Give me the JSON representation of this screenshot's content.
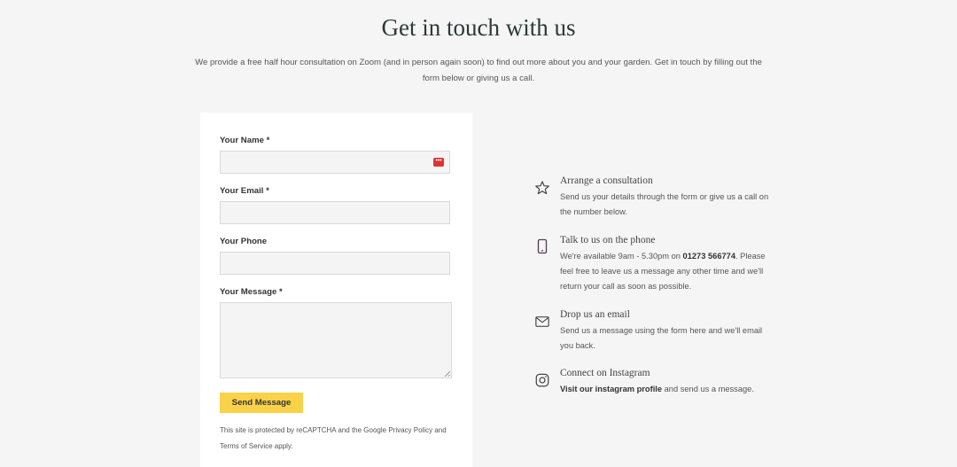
{
  "header": {
    "title": "Get in touch with us",
    "intro": "We provide a free half hour consultation on Zoom (and in person again soon) to find out more about you and your garden. Get in touch by filling out the form below or giving us a call."
  },
  "form": {
    "name_label": "Your Name *",
    "name_value": "",
    "email_label": "Your Email *",
    "email_value": "",
    "phone_label": "Your Phone",
    "phone_value": "",
    "message_label": "Your Message *",
    "message_value": "",
    "password_manager_icon": "password-manager-icon",
    "password_manager_glyph": "•••",
    "submit_label": "Send Message",
    "recaptcha_notice": "This site is protected by reCAPTCHA and the Google Privacy Policy and Terms of Service apply."
  },
  "info": {
    "consultation": {
      "icon": "star-icon",
      "title": "Arrange a consultation",
      "text": "Send us your details through the form or give us a call on the number below."
    },
    "phone": {
      "icon": "phone-icon",
      "title": "Talk to us on the phone",
      "text_prefix": "We're available 9am - 5.30pm on ",
      "number": "01273 566774",
      "text_suffix": ". Please feel free to leave us a message any other time and we'll return your call as soon as possible."
    },
    "email": {
      "icon": "envelope-icon",
      "title": "Drop us an email",
      "text": "Send us a message using the form here and we'll email you back."
    },
    "instagram": {
      "icon": "instagram-icon",
      "title": "Connect on Instagram",
      "link_text": "Visit our instagram profile",
      "text_suffix": " and send us a message."
    }
  },
  "colors": {
    "background": "#f5f5f5",
    "button": "#f9d249",
    "title": "#2b3a36",
    "icon_accent": "#5b3a55"
  }
}
